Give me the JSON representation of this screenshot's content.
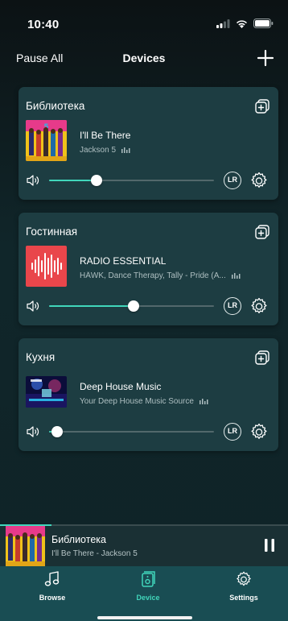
{
  "status_bar": {
    "time": "10:40"
  },
  "header": {
    "pause_all_label": "Pause All",
    "title": "Devices",
    "add_icon": "plus-icon"
  },
  "devices": [
    {
      "room": "Библиотека",
      "track_title": "I'll Be There",
      "track_subtitle": "Jackson 5",
      "art_icon": "jackson5-album-art",
      "volume_percent": 29,
      "channel_label": "LR"
    },
    {
      "room": "Гостинная",
      "track_title": "RADIO ESSENTIAL",
      "track_subtitle": "HÄWK, Dance Therapy, Tally - Pride (A...",
      "art_icon": "radio-waveform-art",
      "volume_percent": 51,
      "channel_label": "LR"
    },
    {
      "room": "Кухня",
      "track_title": "Deep House Music",
      "track_subtitle": "Your Deep House Music Source",
      "art_icon": "deep-house-art",
      "volume_percent": 5,
      "channel_label": "LR"
    }
  ],
  "now_playing": {
    "room": "Библиотека",
    "track": "I'll Be There - Jackson 5",
    "progress_percent": 18
  },
  "tabs": [
    {
      "label": "Browse",
      "icon": "music-note-icon",
      "active": false
    },
    {
      "label": "Device",
      "icon": "speaker-device-icon",
      "active": true
    },
    {
      "label": "Settings",
      "icon": "gear-icon",
      "active": false
    }
  ],
  "colors": {
    "accent": "#41d6bb",
    "card_background": "#1d3d42",
    "tab_bar": "#194d53"
  }
}
